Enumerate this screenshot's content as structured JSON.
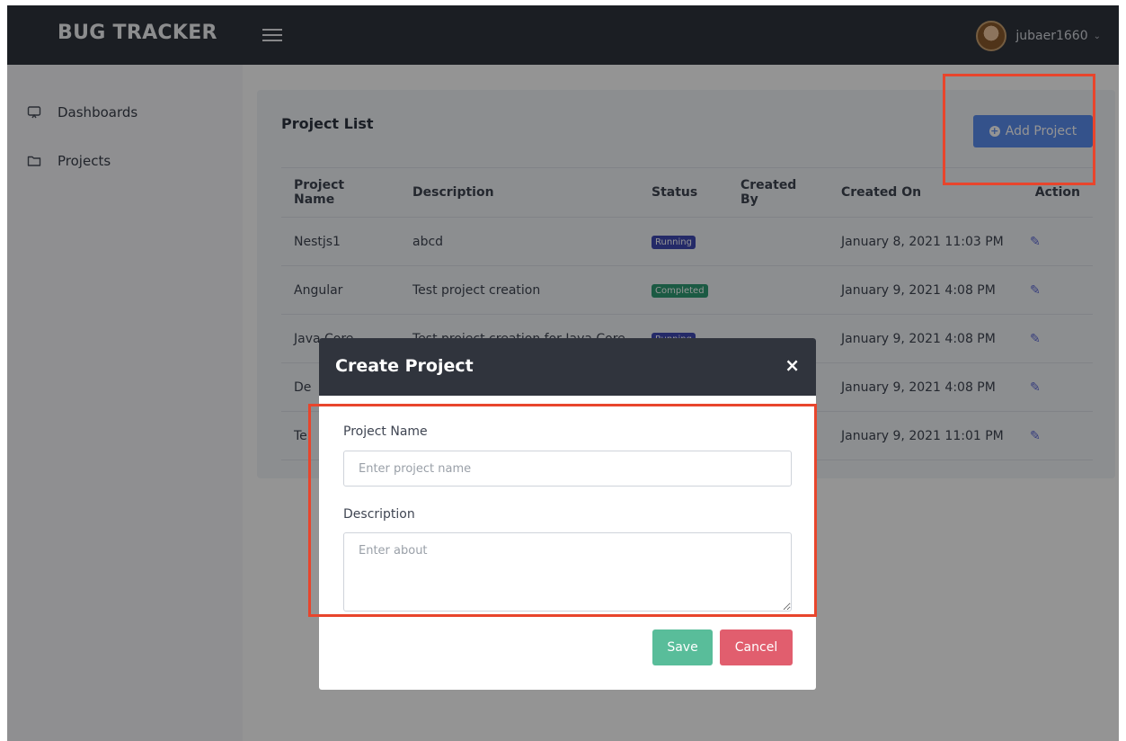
{
  "app": {
    "brand": "BUG TRACKER",
    "user": {
      "name": "jubaer1660"
    }
  },
  "sidebar": {
    "items": [
      {
        "label": "Dashboards",
        "icon": "monitor-icon"
      },
      {
        "label": "Projects",
        "icon": "folder-icon"
      }
    ]
  },
  "project_list": {
    "title": "Project List",
    "add_button": "Add Project",
    "columns": [
      "Project Name",
      "Description",
      "Status",
      "Created By",
      "Created On",
      "Action"
    ],
    "rows": [
      {
        "name": "Nestjs1",
        "description": "abcd",
        "status": "Running",
        "created_by": "",
        "created_on": "January 8, 2021 11:03 PM"
      },
      {
        "name": "Angular",
        "description": "Test project creation",
        "status": "Completed",
        "created_by": "",
        "created_on": "January 9, 2021 4:08 PM"
      },
      {
        "name": "Java Core",
        "description": "Test project creation for Java Core",
        "status": "Running",
        "created_by": "",
        "created_on": "January 9, 2021 4:08 PM"
      },
      {
        "name": "De",
        "description": "",
        "status": "",
        "created_by": "",
        "created_on": "January 9, 2021 4:08 PM"
      },
      {
        "name": "Te",
        "description": "",
        "status": "",
        "created_by": "",
        "created_on": "January 9, 2021 11:01 PM"
      }
    ]
  },
  "modal": {
    "title": "Create Project",
    "close": "×",
    "name_label": "Project Name",
    "name_placeholder": "Enter project name",
    "name_value": "",
    "description_label": "Description",
    "description_placeholder": "Enter about",
    "description_value": "",
    "save": "Save",
    "cancel": "Cancel"
  },
  "colors": {
    "header": "#30343d",
    "primary": "#5b8def",
    "save": "#59bd9a",
    "cancel": "#e15e6e",
    "running_badge": "#3f49b3",
    "completed_badge": "#2f9c74",
    "highlight": "#e8452c"
  }
}
